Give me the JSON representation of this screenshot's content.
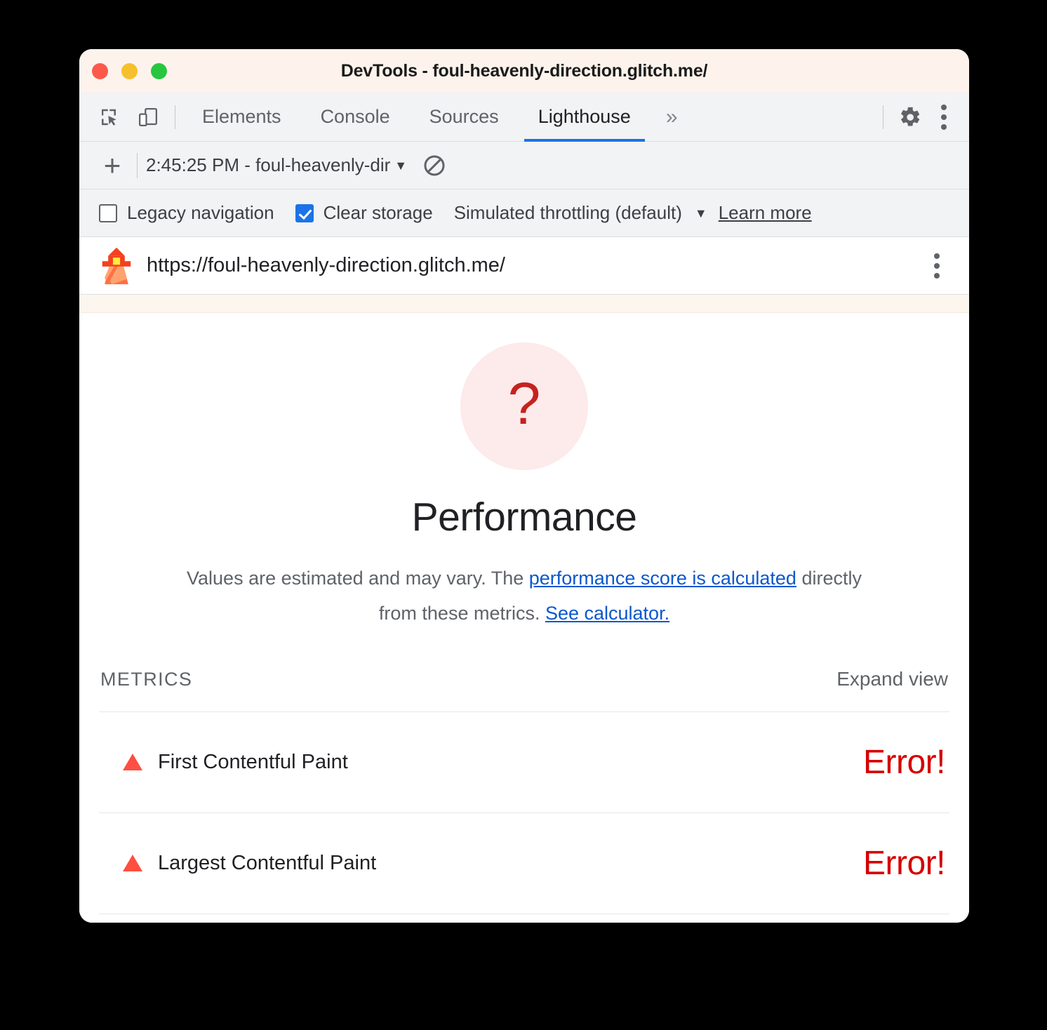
{
  "window": {
    "title": "DevTools - foul-heavenly-direction.glitch.me/",
    "traffic_lights": [
      "close",
      "minimize",
      "maximize"
    ]
  },
  "tabbar": {
    "inspect_icon": "inspect-element-icon",
    "device_icon": "device-toolbar-icon",
    "tabs": [
      {
        "label": "Elements",
        "active": false
      },
      {
        "label": "Console",
        "active": false
      },
      {
        "label": "Sources",
        "active": false
      },
      {
        "label": "Lighthouse",
        "active": true
      }
    ],
    "overflow_label": "»",
    "settings_icon": "gear-icon",
    "more_icon": "kebab-menu-icon",
    "active_tab_accent": "#1a73e8"
  },
  "runbar": {
    "add_label": "+",
    "report_select_value": "2:45:25 PM - foul-heavenly-dir",
    "caret": "▼",
    "clear_icon": "no-entry-clear-icon"
  },
  "settings": {
    "legacy_navigation": {
      "label": "Legacy navigation",
      "checked": false
    },
    "clear_storage": {
      "label": "Clear storage",
      "checked": true
    },
    "throttling": {
      "label": "Simulated throttling (default)",
      "caret": "▼"
    },
    "learn_more": "Learn more"
  },
  "urlbar": {
    "lighthouse_icon": "lighthouse-icon",
    "url": "https://foul-heavenly-direction.glitch.me/",
    "more_icon": "kebab-menu-icon"
  },
  "report": {
    "gauge": {
      "score_symbol": "?",
      "title": "Performance",
      "circle_color": "#fdeaea",
      "symbol_color": "#c5221f"
    },
    "description": {
      "part1": "Values are estimated and may vary. The ",
      "link1": "performance score is calculated",
      "part2": " directly from these metrics. ",
      "link2": "See calculator.",
      "link_color": "#0b57d0"
    },
    "metrics_section": {
      "heading": "METRICS",
      "expand_view": "Expand view",
      "rows": [
        {
          "icon": "warning-triangle-icon",
          "name": "First Contentful Paint",
          "value": "Error!",
          "value_color": "#d50000"
        },
        {
          "icon": "warning-triangle-icon",
          "name": "Largest Contentful Paint",
          "value": "Error!",
          "value_color": "#d50000"
        }
      ]
    }
  }
}
